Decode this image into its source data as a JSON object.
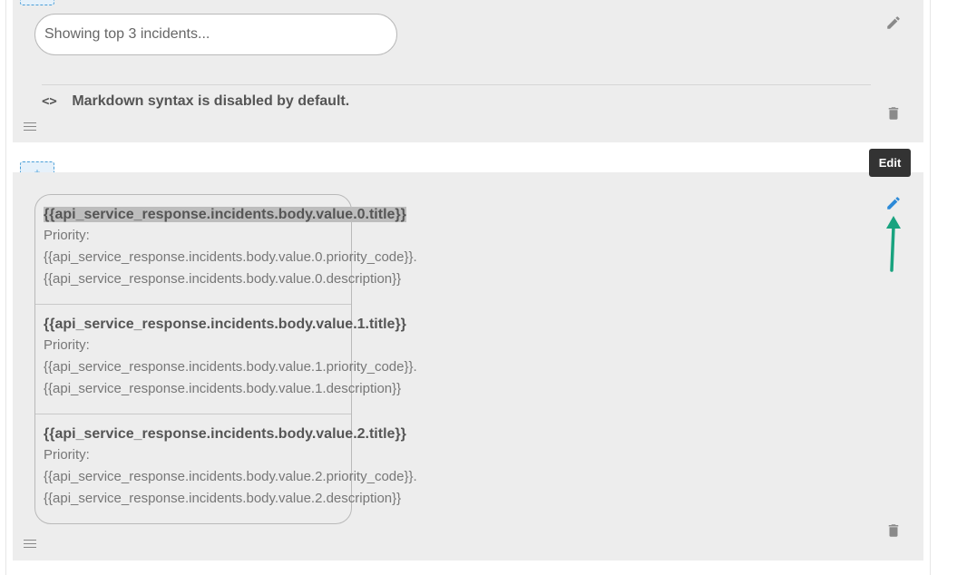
{
  "top_block": {
    "input_value": "Showing top 3 incidents...",
    "markdown_note": "Markdown syntax is disabled by default.",
    "code_glyph": "<>"
  },
  "add_button_label": "+",
  "tooltip_label": "Edit",
  "incidents": [
    {
      "title": "{{api_service_response.incidents.body.value.0.title}}",
      "priority_label": "Priority:",
      "priority_code": "{{api_service_response.incidents.body.value.0.priority_code}}.",
      "description": "{{api_service_response.incidents.body.value.0.description}}"
    },
    {
      "title": "{{api_service_response.incidents.body.value.1.title}}",
      "priority_label": "Priority:",
      "priority_code": "{{api_service_response.incidents.body.value.1.priority_code}}.",
      "description": "{{api_service_response.incidents.body.value.1.description}}"
    },
    {
      "title": "{{api_service_response.incidents.body.value.2.title}}",
      "priority_label": "Priority:",
      "priority_code": "{{api_service_response.incidents.body.value.2.priority_code}}.",
      "description": "{{api_service_response.incidents.body.value.2.description}}"
    }
  ],
  "colors": {
    "accent_blue": "#2d8ad8",
    "arrow_green": "#19a37f",
    "block_bg": "#ededed",
    "icon_grey": "#8a8a8a"
  },
  "icons": [
    "pencil-icon",
    "trash-icon",
    "drag-handle-icon",
    "code-icon",
    "plus-icon",
    "arrow-up-icon"
  ]
}
